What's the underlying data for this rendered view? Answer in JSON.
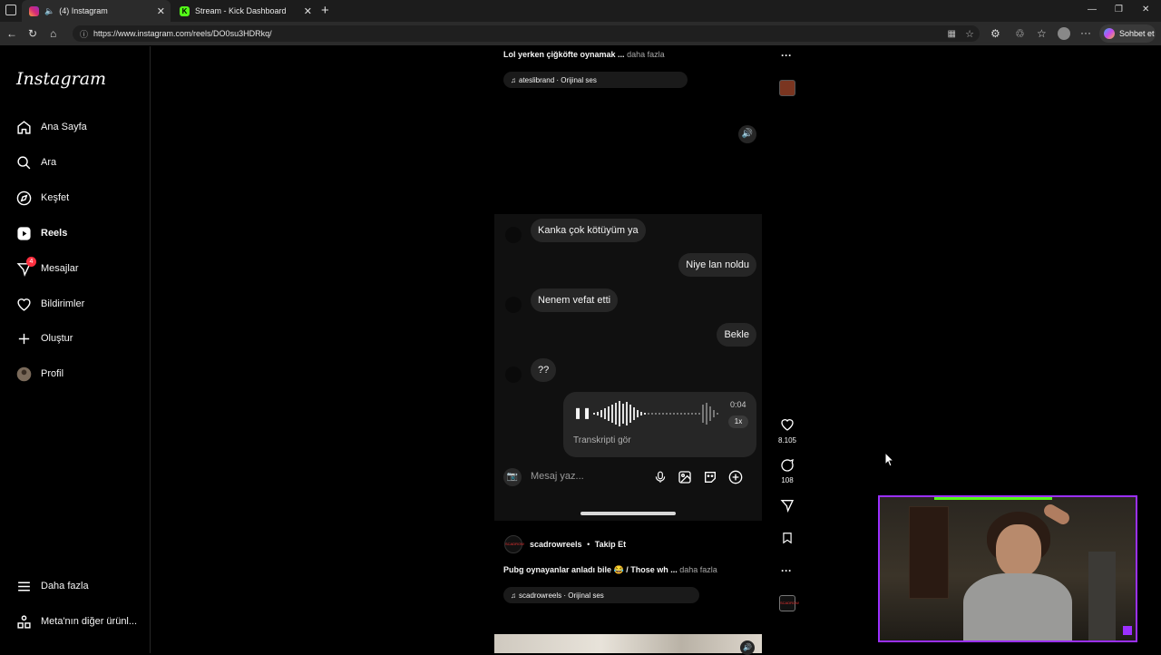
{
  "browser": {
    "tabs": [
      {
        "label": "(4) Instagram",
        "icon": "instagram-icon"
      },
      {
        "label": "Stream - Kick Dashboard",
        "icon": "kick-icon"
      }
    ],
    "url": "https://www.instagram.com/reels/DO0su3HDRkq/",
    "copilot_label": "Sohbet et"
  },
  "sidebar": {
    "logo": "Instagram",
    "items": [
      {
        "label": "Ana Sayfa",
        "icon": "home-icon"
      },
      {
        "label": "Ara",
        "icon": "search-icon"
      },
      {
        "label": "Keşfet",
        "icon": "compass-icon"
      },
      {
        "label": "Reels",
        "icon": "reels-icon"
      },
      {
        "label": "Mesajlar",
        "icon": "messenger-icon"
      },
      {
        "label": "Bildirimler",
        "icon": "heart-icon"
      },
      {
        "label": "Oluştur",
        "icon": "plus-icon"
      },
      {
        "label": "Profil",
        "icon": "avatar"
      }
    ],
    "messages_badge": "4",
    "more_label": "Daha fazla",
    "meta_label": "Meta'nın diğer ürünl..."
  },
  "reel1": {
    "caption": "Lol yerken çiğköfte oynamak ...",
    "more": "daha fazla",
    "audio": "ateslibrand · Orijinal ses"
  },
  "chat": {
    "msg1": "Kanka çok kötüyüm ya",
    "msg2": "Niye lan noldu",
    "msg3": "Nenem vefat etti",
    "msg4": "Bekle",
    "msg5": "??",
    "voice_time": "0:04",
    "voice_speed": "1x",
    "voice_transcript": "Transkripti gör",
    "input_placeholder": "Mesaj yaz..."
  },
  "actions": {
    "likes": "8.105",
    "comments": "108"
  },
  "reel2": {
    "username": "scadrowreels",
    "separator": "•",
    "follow": "Takip Et",
    "caption": "Pubg oynayanlar anladı bile 😂 / Those wh ...",
    "more": "daha fazla",
    "audio": "scadrowreels · Orijinal ses",
    "avatar_text": "SCADROW"
  },
  "colors": {
    "accent_stream": "#9b30ff",
    "kick_green": "#53fc18",
    "badge_red": "#ff3040"
  }
}
